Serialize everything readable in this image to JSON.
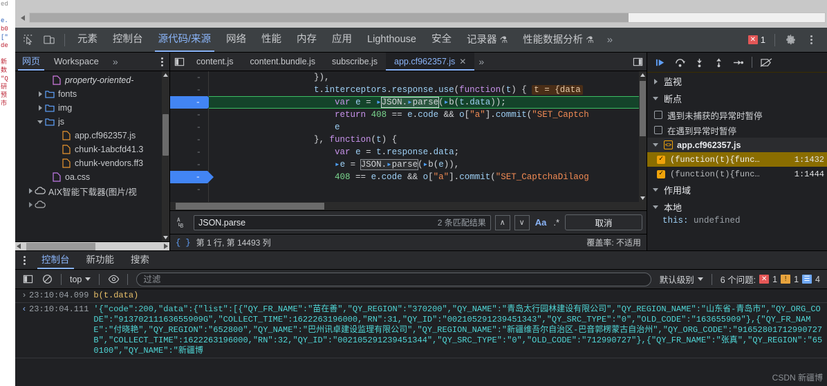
{
  "window": {
    "scrollbar_present": true
  },
  "main_toolbar": {
    "icons": [
      {
        "name": "inspect-element-icon",
        "glyph": "inspect"
      },
      {
        "name": "device-toolbar-icon",
        "glyph": "device"
      }
    ],
    "tabs": [
      {
        "label": "元素",
        "active": false,
        "experimental": false
      },
      {
        "label": "控制台",
        "active": false,
        "experimental": false
      },
      {
        "label": "源代码/来源",
        "active": true,
        "experimental": false
      },
      {
        "label": "网络",
        "active": false,
        "experimental": false
      },
      {
        "label": "性能",
        "active": false,
        "experimental": false
      },
      {
        "label": "内存",
        "active": false,
        "experimental": false
      },
      {
        "label": "应用",
        "active": false,
        "experimental": false
      },
      {
        "label": "Lighthouse",
        "active": false,
        "experimental": false
      },
      {
        "label": "安全",
        "active": false,
        "experimental": false
      },
      {
        "label": "记录器",
        "active": false,
        "experimental": true
      },
      {
        "label": "性能数据分析",
        "active": false,
        "experimental": true
      }
    ],
    "overflow_label": "»",
    "error_count": "1",
    "settings_icon": "gear-icon",
    "more_icon": "more-vertical-icon"
  },
  "navigator": {
    "tabs": [
      {
        "label": "网页",
        "active": true
      },
      {
        "label": "Workspace",
        "active": false
      }
    ],
    "overflow_label": "»",
    "more_icon": "more-vertical-icon",
    "tree": [
      {
        "label": "property-oriented-",
        "indent": 3,
        "arrow": "none",
        "icon": "page-file-icon",
        "italic": true
      },
      {
        "label": "fonts",
        "indent": 2,
        "arrow": "collapsed",
        "icon": "folder-icon",
        "italic": false
      },
      {
        "label": "img",
        "indent": 2,
        "arrow": "collapsed",
        "icon": "folder-icon",
        "italic": false
      },
      {
        "label": "js",
        "indent": 2,
        "arrow": "expanded",
        "icon": "folder-icon",
        "italic": false
      },
      {
        "label": "app.cf962357.js",
        "indent": 4,
        "arrow": "none",
        "icon": "js-file-icon",
        "italic": false
      },
      {
        "label": "chunk-1abcfd41.3",
        "indent": 4,
        "arrow": "none",
        "icon": "js-file-icon",
        "italic": false
      },
      {
        "label": "chunk-vendors.ff3",
        "indent": 4,
        "arrow": "none",
        "icon": "js-file-icon",
        "italic": false
      },
      {
        "label": "oa.css",
        "indent": 3,
        "arrow": "none",
        "icon": "css-file-icon",
        "italic": false
      },
      {
        "label": "AIX智能下载器(图片/视",
        "indent": 1,
        "arrow": "collapsed",
        "icon": "cloud-icon",
        "italic": false
      }
    ]
  },
  "editor": {
    "tabs": [
      {
        "label": "content.js",
        "active": false,
        "closable": false
      },
      {
        "label": "content.bundle.js",
        "active": false,
        "closable": false
      },
      {
        "label": "subscribe.js",
        "active": false,
        "closable": false
      },
      {
        "label": "app.cf962357.js",
        "active": true,
        "closable": true
      }
    ],
    "overflow_label": "»",
    "left_panel_icon": "show-navigator-icon",
    "right_panel_icon": "show-debugger-icon",
    "gutter_marks": [
      "-",
      "-",
      "-",
      "-",
      "-",
      "-",
      "-",
      "-",
      "-",
      "-"
    ],
    "breakpoint_lines": [
      2,
      8
    ],
    "execution_line": 2,
    "lines": [
      {
        "text": "                    }),",
        "tokens": [
          {
            "t": "                    }),",
            "c": "plain"
          }
        ]
      },
      {
        "text": "                    t.interceptors.response.use(function(t) {   t = {data",
        "tokens": []
      },
      {
        "text": "                        var e = JSON.parse(b(t.data));",
        "tokens": []
      },
      {
        "text": "                        return 408 == e.code && o[\"a\"].commit(\"SET_Captch",
        "tokens": []
      },
      {
        "text": "                        e",
        "tokens": []
      },
      {
        "text": "                    }, function(t) {",
        "tokens": []
      },
      {
        "text": "                        var e = t.response.data;",
        "tokens": []
      },
      {
        "text": "                        e = JSON.parse(b(e)),",
        "tokens": []
      },
      {
        "text": "                        408 == e.code && o[\"a\"].commit(\"SET_CaptchaDilaog",
        "tokens": []
      }
    ],
    "inline_value": "t = {data"
  },
  "search": {
    "icon": "case-replace-icon",
    "query": "JSON.parse",
    "placeholder": "",
    "match_count": "2 条匹配结果",
    "prev_label": "∧",
    "next_label": "∨",
    "match_case_label": "Aa",
    "regex_label": ".*",
    "cancel_label": "取消"
  },
  "status": {
    "format_icon": "pretty-print-icon",
    "position": "第 1 行, 第 14493 列",
    "coverage": "覆盖率: 不适用"
  },
  "debugger": {
    "toolbar": [
      {
        "name": "resume-script-icon",
        "title": "恢复"
      },
      {
        "name": "step-over-icon",
        "title": "跳过"
      },
      {
        "name": "step-into-icon",
        "title": "进入"
      },
      {
        "name": "step-out-icon",
        "title": "跳出"
      },
      {
        "name": "step-icon",
        "title": "单步"
      },
      {
        "name": "deactivate-breakpoints-icon",
        "title": "停用断点"
      }
    ],
    "sections": [
      {
        "label": "监视",
        "expanded": false
      },
      {
        "label": "断点",
        "expanded": true
      }
    ],
    "pause_options": [
      {
        "label": "遇到未捕获的异常时暂停",
        "checked": false
      },
      {
        "label": "在遇到异常时暂停",
        "checked": false
      }
    ],
    "breakpoint_file": "app.cf962357.js",
    "breakpoints": [
      {
        "snippet": "(function(t){func…",
        "location": "1:1432",
        "checked": true,
        "selected": true
      },
      {
        "snippet": "(function(t){func…",
        "location": "1:1444",
        "checked": true,
        "selected": false
      }
    ],
    "scope_label": "作用域",
    "local_label": "本地",
    "local_entries": [
      {
        "name": "this:",
        "value": "undefined"
      }
    ]
  },
  "drawer": {
    "more_icon": "more-vertical-icon",
    "tabs": [
      {
        "label": "控制台",
        "active": true
      },
      {
        "label": "新功能",
        "active": false
      },
      {
        "label": "搜索",
        "active": false
      }
    ],
    "toolbar": {
      "sidebar_icon": "console-sidebar-icon",
      "clear_icon": "clear-console-icon",
      "context": "top",
      "eye_icon": "live-expression-icon",
      "filter_placeholder": "过滤",
      "filter_value": "",
      "level": "默认级别",
      "issues_label": "6 个问题:",
      "issue_errors": "1",
      "issue_warnings": "1",
      "issue_infos": "4"
    },
    "messages": [
      {
        "kind": "input",
        "arrow": "›",
        "time": "23:10:04.099",
        "text": "b(t.data)"
      },
      {
        "kind": "output",
        "arrow": "‹",
        "time": "23:10:04.111",
        "text": "'{\"code\":200,\"data\":{\"list\":[{\"QY_FR_NAME\":\"苗在善\",\"QY_REGION\":\"370200\",\"QY_NAME\":\"青岛太行园林建设有限公司\",\"QY_REGION_NAME\":\"山东省-青岛市\",\"QY_ORG_CODE\":\"91370211163655909G\",\"COLLECT_TIME\":1622263196000,\"RN\":31,\"QY_ID\":\"002105291239451343\",\"QY_SRC_TYPE\":\"0\",\"OLD_CODE\":\"163655909\"},{\"QY_FR_NAME\":\"付晓艳\",\"QY_REGION\":\"652800\",\"QY_NAME\":\"巴州讯卓建设监理有限公司\",\"QY_REGION_NAME\":\"新疆维吾尔自治区-巴音郭楞蒙古自治州\",\"QY_ORG_CODE\":\"91652801712990727B\",\"COLLECT_TIME\":1622263196000,\"RN\":32,\"QY_ID\":\"002105291239451344\",\"QY_SRC_TYPE\":\"0\",\"OLD_CODE\":\"712990727\"},{\"QY_FR_NAME\":\"张真\",\"QY_REGION\":\"650100\",\"QY_NAME\":\"新疆博"
      }
    ],
    "watermark": "CSDN 新疆博"
  }
}
